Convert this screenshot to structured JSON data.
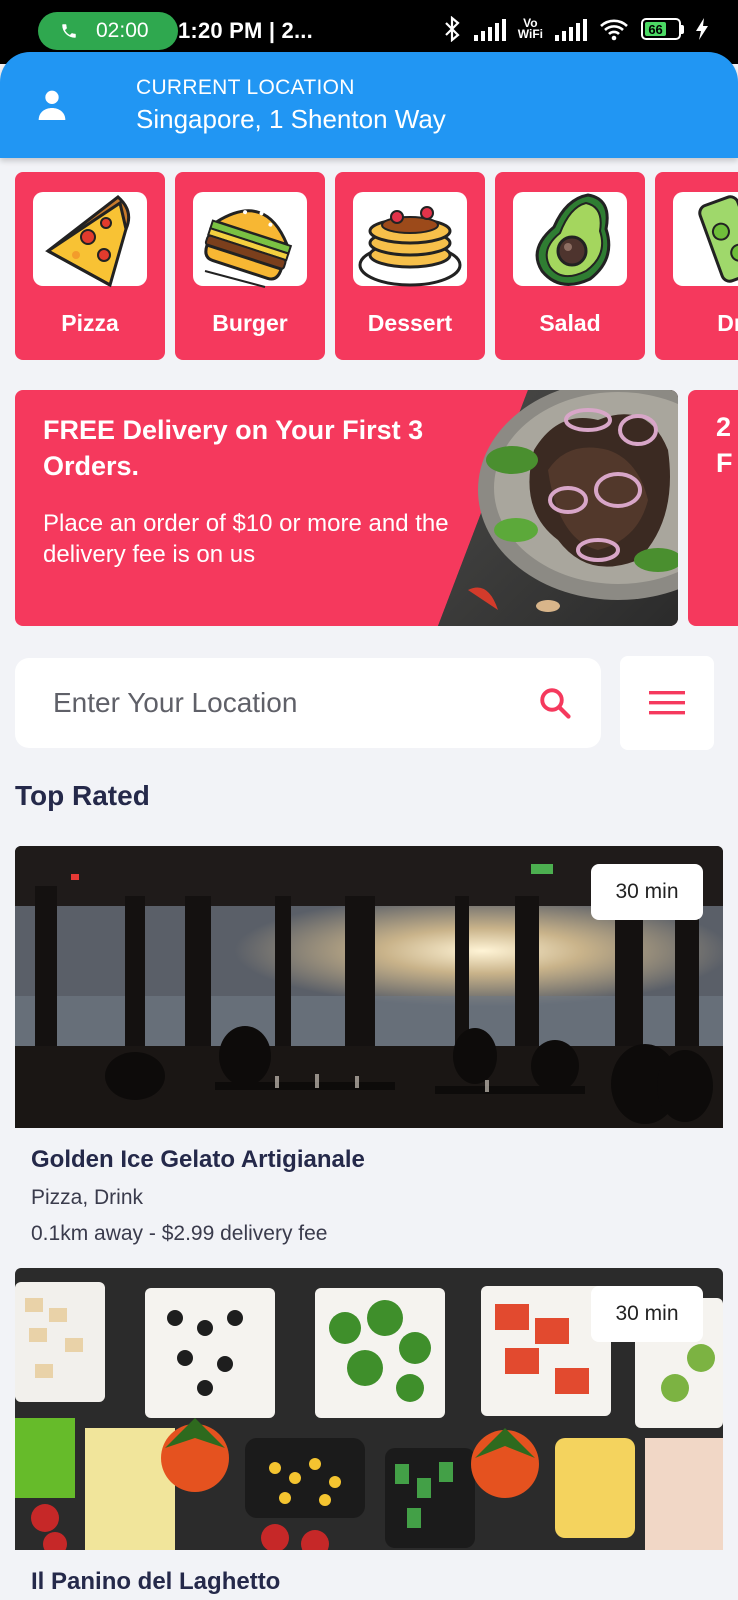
{
  "status_bar": {
    "call_timer": "02:00",
    "time": "1:20 PM | 2...",
    "vowifi_top": "Vo",
    "vowifi_bottom": "WiFi",
    "battery": "66"
  },
  "header": {
    "location_label": "CURRENT LOCATION",
    "location_value": "Singapore, 1 Shenton Way"
  },
  "categories": [
    {
      "label": "Pizza",
      "icon": "pizza-icon"
    },
    {
      "label": "Burger",
      "icon": "burger-icon"
    },
    {
      "label": "Dessert",
      "icon": "pancake-icon"
    },
    {
      "label": "Salad",
      "icon": "avocado-icon"
    },
    {
      "label": "Dr",
      "icon": "drink-icon"
    }
  ],
  "promo": {
    "title": "FREE Delivery on Your First 3 Orders.",
    "subtitle": "Place an order of $10 or more and the delivery fee is on us",
    "next_peek_1": "2",
    "next_peek_2": "F"
  },
  "search": {
    "placeholder": "Enter Your Location"
  },
  "section": {
    "title": "Top Rated"
  },
  "restaurants": [
    {
      "eta": "30 min",
      "name": "Golden Ice Gelato Artigianale",
      "tags": "Pizza, Drink",
      "meta": "0.1km away - $2.99 delivery fee"
    },
    {
      "eta": "30 min",
      "name": "Il Panino del Laghetto"
    }
  ],
  "colors": {
    "accent": "#f5395d",
    "header": "#2196f3",
    "background": "#f2f3f7"
  }
}
